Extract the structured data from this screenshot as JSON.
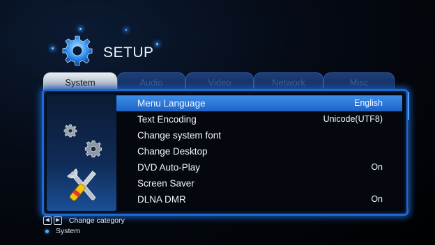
{
  "header": {
    "title": "SETUP",
    "icon": "gear-icon"
  },
  "tabs": [
    {
      "label": "System",
      "active": true
    },
    {
      "label": "Audio",
      "active": false
    },
    {
      "label": "Video",
      "active": false
    },
    {
      "label": "Network",
      "active": false
    },
    {
      "label": "Misc",
      "active": false
    }
  ],
  "settings": [
    {
      "label": "Menu Language",
      "value": "English",
      "selected": true
    },
    {
      "label": "Text Encoding",
      "value": "Unicode(UTF8)",
      "selected": false
    },
    {
      "label": "Change system font",
      "value": "",
      "selected": false
    },
    {
      "label": "Change Desktop",
      "value": "",
      "selected": false
    },
    {
      "label": "DVD Auto-Play",
      "value": "On",
      "selected": false
    },
    {
      "label": "Screen Saver",
      "value": "",
      "selected": false
    },
    {
      "label": "DLNA DMR",
      "value": "On",
      "selected": false
    }
  ],
  "footer": {
    "hint": "Change category",
    "current": "System"
  },
  "colors": {
    "accent": "#1e6ad0",
    "highlight": "#3d8ee8"
  }
}
